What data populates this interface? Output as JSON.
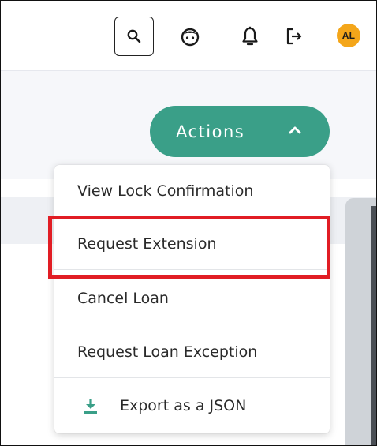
{
  "header": {
    "icons": [
      "search-icon",
      "face-icon",
      "bell-icon",
      "logout-icon"
    ],
    "avatar_initials": "AL",
    "avatar_color": "#f4a61a"
  },
  "actions": {
    "label": "Actions",
    "icon": "chevron-up-icon",
    "color": "#3a9f88"
  },
  "menu": {
    "items": [
      {
        "label": "View Lock Confirmation"
      },
      {
        "label": "Request Extension"
      },
      {
        "label": "Cancel Loan"
      },
      {
        "label": "Request Loan Exception"
      },
      {
        "label": "Export as a JSON",
        "icon": "download-icon"
      }
    ],
    "highlighted_item": "Request Extension",
    "highlight_color": "#e11d24"
  }
}
